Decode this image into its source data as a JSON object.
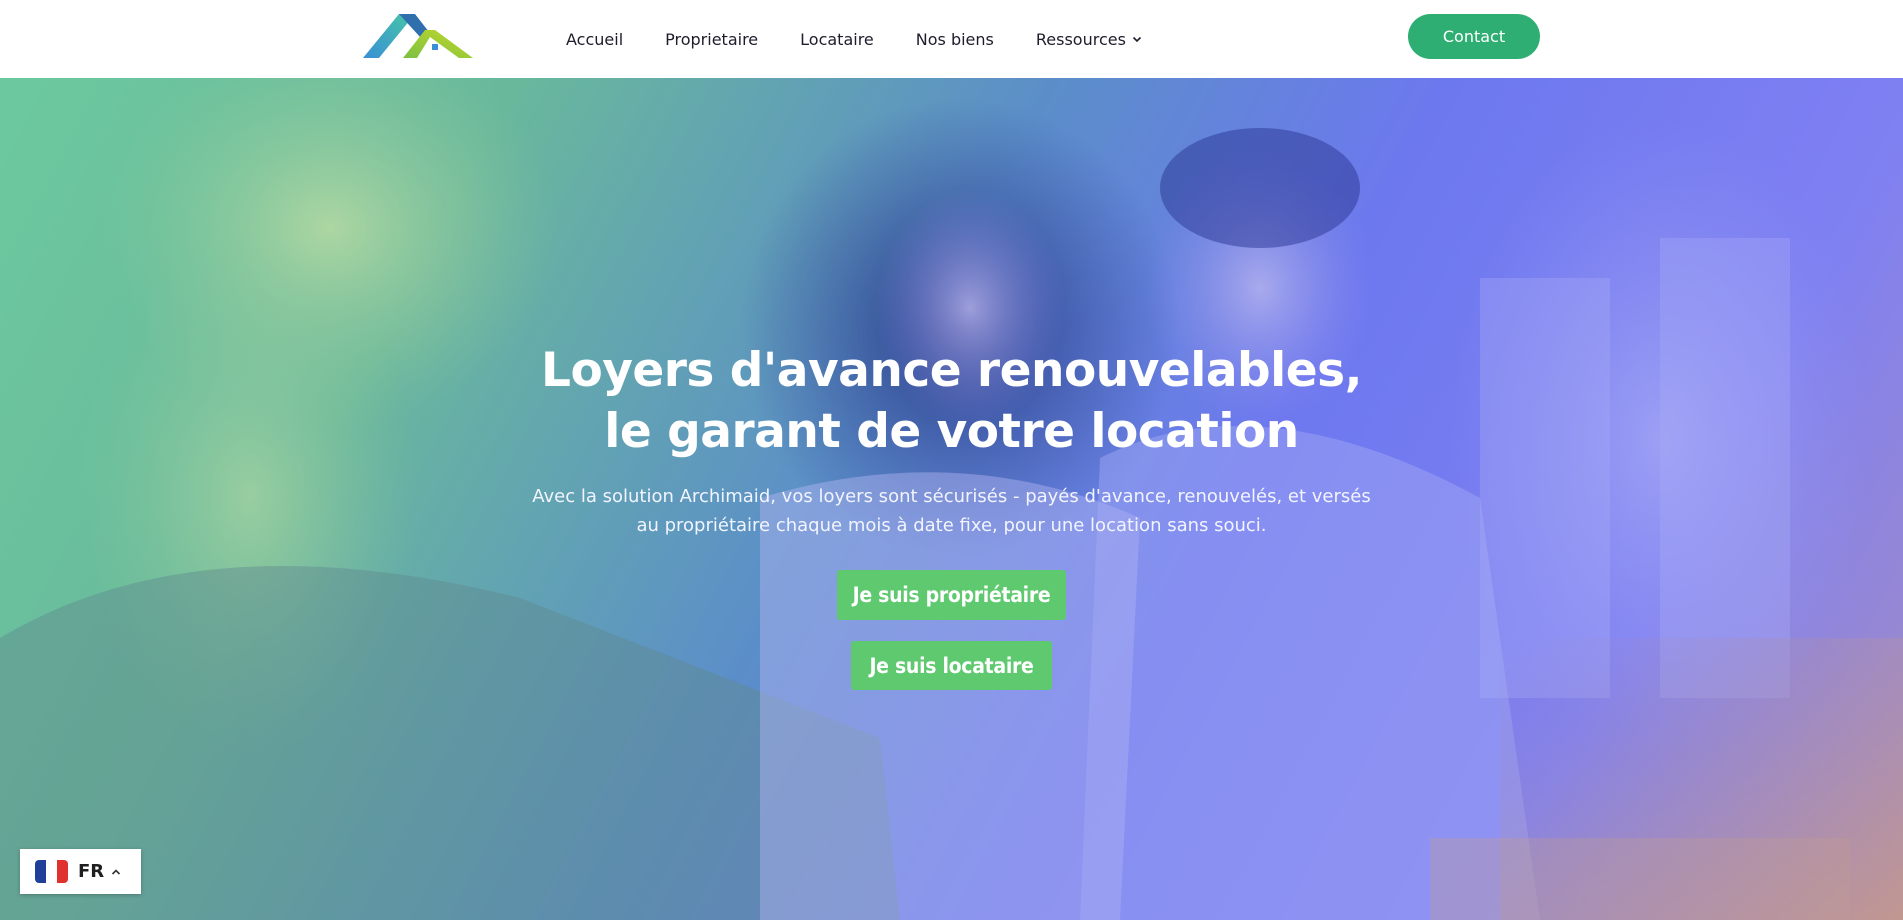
{
  "nav": {
    "items": [
      {
        "label": "Accueil"
      },
      {
        "label": "Proprietaire"
      },
      {
        "label": "Locataire"
      },
      {
        "label": "Nos biens"
      },
      {
        "label": "Ressources",
        "icon": "chevron-down-icon"
      }
    ],
    "contact_label": "Contact"
  },
  "hero": {
    "title_line1": "Loyers d'avance renouvelables,",
    "title_line2": "le garant de votre location",
    "subtitle": "Avec la solution Archimaid, vos loyers sont sécurisés - payés d'avance, renouvelés, et versés au propriétaire chaque mois à date fixe, pour une location sans souci.",
    "cta_owner": "Je suis propriétaire",
    "cta_tenant": "Je suis locataire"
  },
  "lang": {
    "code": "FR",
    "flag_icon": "france-flag-icon",
    "toggle_icon": "chevron-up-icon"
  },
  "colors": {
    "brand_green": "#2eae73",
    "cta_green": "#5ec96f",
    "hero_gradient_start": "#6cc99e",
    "hero_gradient_end": "#7f80f2"
  }
}
